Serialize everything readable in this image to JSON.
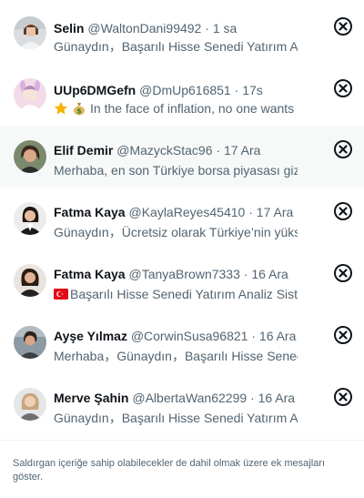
{
  "notifications": [
    {
      "name": "Selin",
      "handle": "@WaltonDani99492",
      "time": "1 sa",
      "text": "Günaydın，Başarılı Hisse Senedi Yatırım Analiz Sistemi",
      "prefix": ""
    },
    {
      "name": "UUp6DMGefn",
      "handle": "@DmUp616851",
      "time": "17s",
      "text": "In the face of inflation, no one wants to lose",
      "prefix": "star-moneybag"
    },
    {
      "name": "Elif Demir",
      "handle": "@MazyckStac96",
      "time": "17 Ara",
      "text": "Merhaba, en son Türkiye borsa piyasası gizli analizi",
      "prefix": ""
    },
    {
      "name": "Fatma Kaya",
      "handle": "@KaylaReyes45410",
      "time": "17 Ara",
      "text": "Günaydın，Ücretsiz olarak Türkiye’nin yüksek getirili",
      "prefix": ""
    },
    {
      "name": "Fatma Kaya",
      "handle": "@TanyaBrown7333",
      "time": "16 Ara",
      "text": "Başarılı Hisse Senedi Yatırım Analiz Sistemi",
      "prefix": "turkey-flag"
    },
    {
      "name": "Ayşe Yılmaz",
      "handle": "@CorwinSusa96821",
      "time": "16 Ara",
      "text": "Merhaba，Günaydın，Başarılı Hisse Senedi Yatırım",
      "prefix": ""
    },
    {
      "name": "Merve Şahin",
      "handle": "@AlbertaWan62299",
      "time": "16 Ara",
      "text": "Günaydın，Başarılı Hisse Senedi Yatırım Analiz",
      "prefix": ""
    }
  ],
  "separator": "·",
  "footer": {
    "text": "Saldırgan içeriğe sahip olabilecekler de dahil olmak üzere ek mesajları göster."
  },
  "colors": {
    "meta": "#536471",
    "name": "#0f1419",
    "highlight": "#f7f9f9"
  },
  "icons": {
    "close": "close-circle-icon"
  }
}
